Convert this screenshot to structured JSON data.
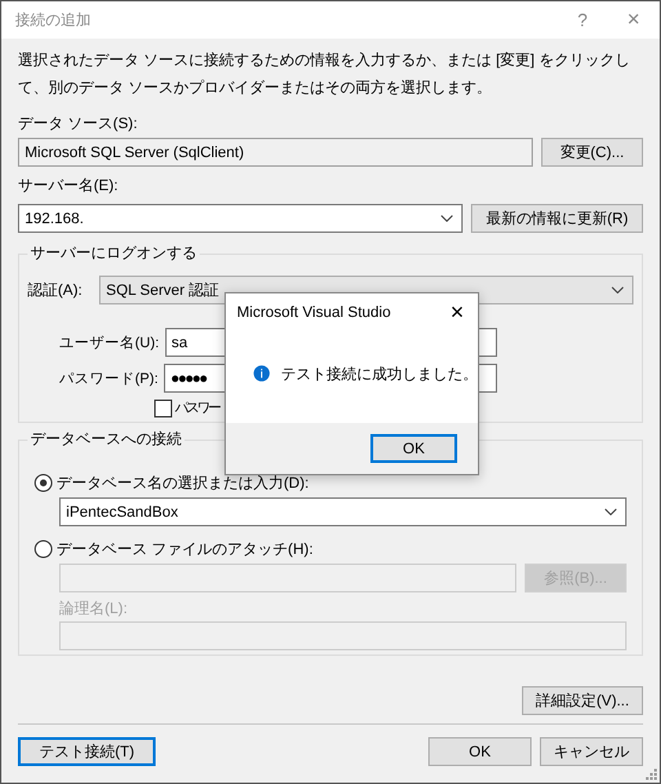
{
  "window": {
    "title": "接続の追加",
    "help_glyph": "?",
    "close_glyph": "×"
  },
  "description": "選択されたデータ ソースに接続するための情報を入力するか、または [変更] をクリックして、別のデータ ソースかプロバイダーまたはその両方を選択します。",
  "data_source": {
    "label": "データ ソース(S):",
    "value": "Microsoft SQL Server (SqlClient)",
    "readonly": true,
    "button": "変更(C)..."
  },
  "server_name": {
    "label": "サーバー名(E):",
    "value": "192.168.",
    "refresh_button": "最新の情報に更新(R)"
  },
  "logon": {
    "title": "サーバーにログオンする",
    "auth_label": "認証(A):",
    "auth_value": "SQL Server 認証",
    "username_label": "ユーザー名(U):",
    "username": "sa",
    "password_label": "パスワード(P):",
    "password_mask": "●●●●●",
    "save_password": {
      "label": "パスワー",
      "checked": false
    }
  },
  "database": {
    "title": "データベースへの接続",
    "options": [
      {
        "label": "データベース名の選択または入力(D):",
        "selected": true
      },
      {
        "label": "データベース ファイルのアタッチ(H):",
        "selected": false
      }
    ],
    "database_name": "iPentecSandBox",
    "attach": {
      "disabled": true,
      "browse_button": "参照(B)...",
      "logical_name_label": "論理名(L):"
    }
  },
  "advanced_button": "詳細設定(V)...",
  "buttons": [
    {
      "label": "テスト接続(T)",
      "focused": true
    },
    {
      "label": "OK",
      "focused": false
    },
    {
      "label": "キャンセル",
      "focused": false
    }
  ],
  "message_box": {
    "title": "Microsoft Visual Studio",
    "close_glyph": "×",
    "message": "テスト接続に成功しました。",
    "button": {
      "label": "OK",
      "focused": true
    }
  }
}
